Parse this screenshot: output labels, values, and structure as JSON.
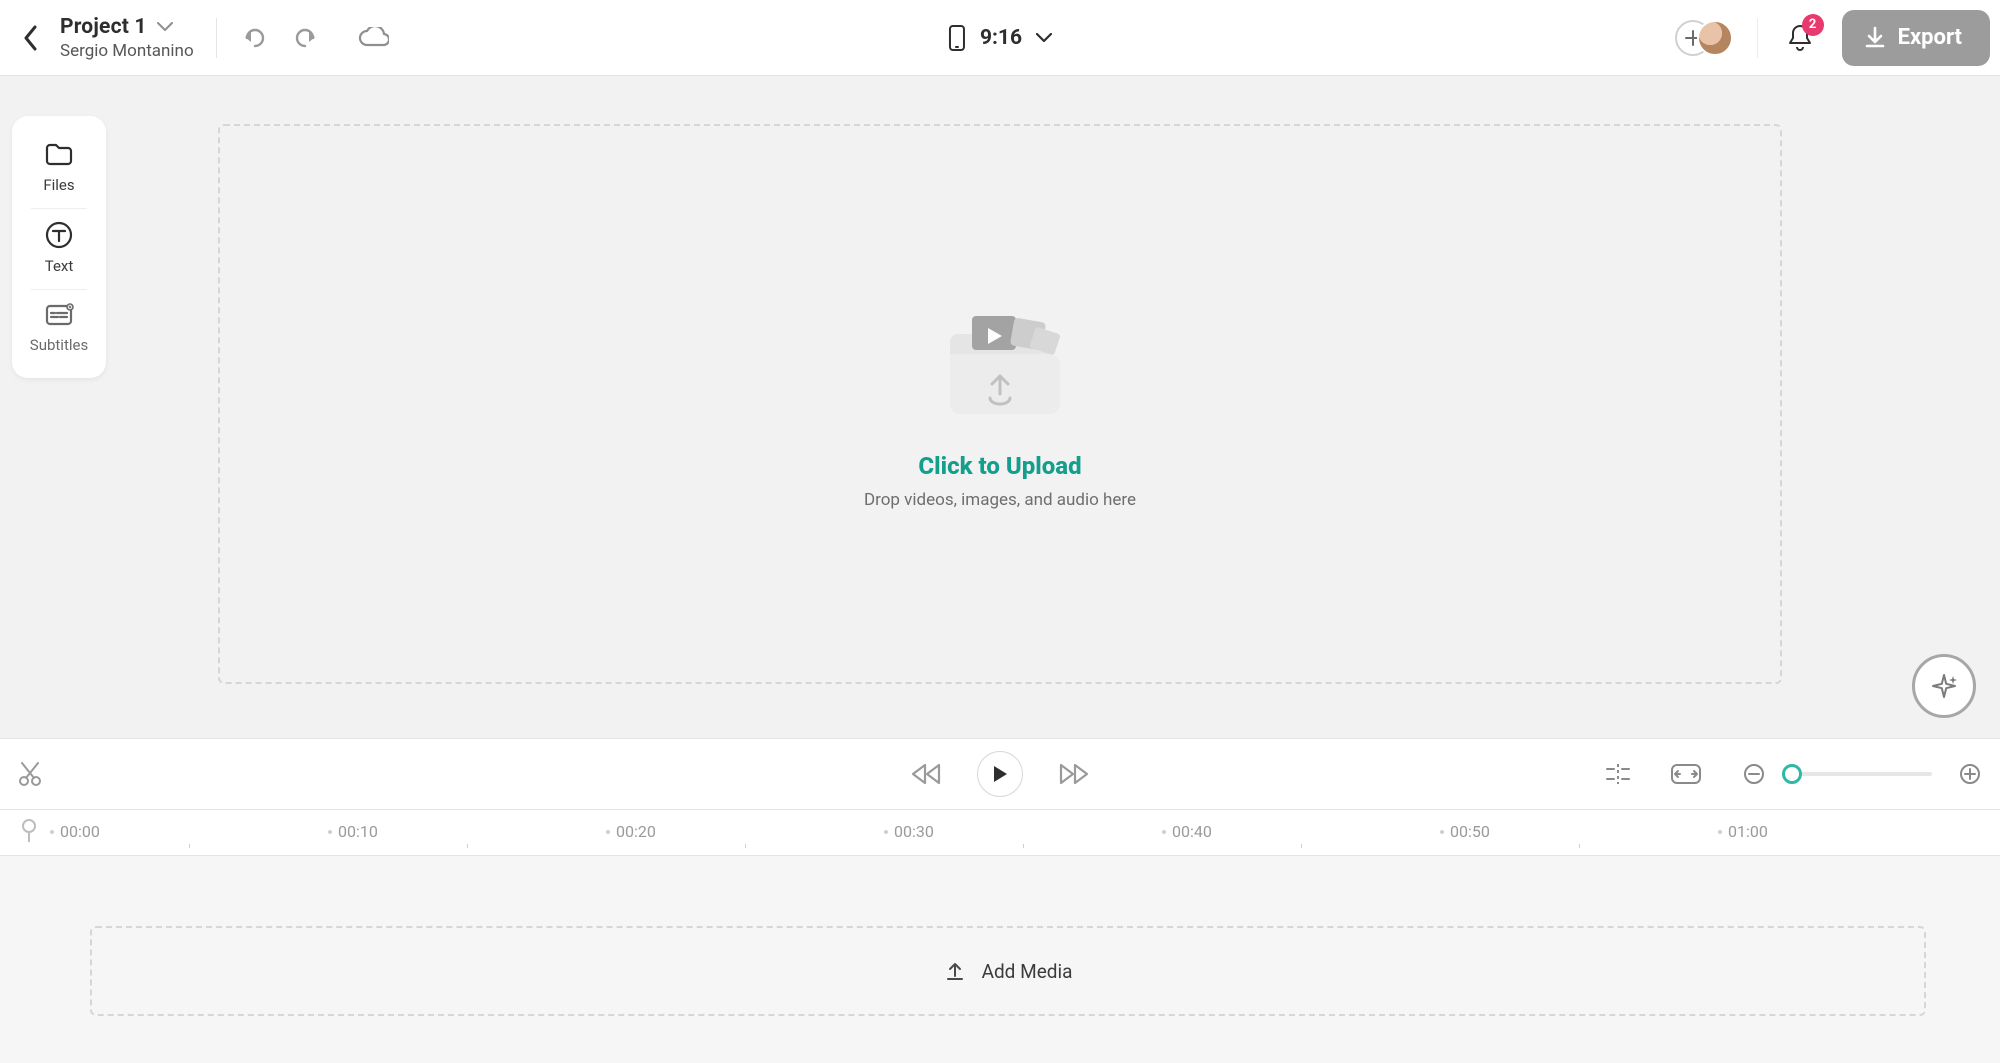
{
  "header": {
    "project_name": "Project 1",
    "user_name": "Sergio Montanino",
    "aspect_label": "9:16",
    "notifications_count": "2",
    "export_label": "Export"
  },
  "left_rail": {
    "items": [
      {
        "label": "Files"
      },
      {
        "label": "Text"
      },
      {
        "label": "Subtitles"
      }
    ]
  },
  "upload": {
    "title": "Click to Upload",
    "subtitle": "Drop videos, images, and audio here"
  },
  "timeline": {
    "add_media_label": "Add Media",
    "ticks": [
      "00:00",
      "00:10",
      "00:20",
      "00:30",
      "00:40",
      "00:50",
      "01:00"
    ]
  },
  "colors": {
    "accent": "#149e8c",
    "badge": "#e93a6f",
    "export_button_bg": "#9c9c9c"
  }
}
